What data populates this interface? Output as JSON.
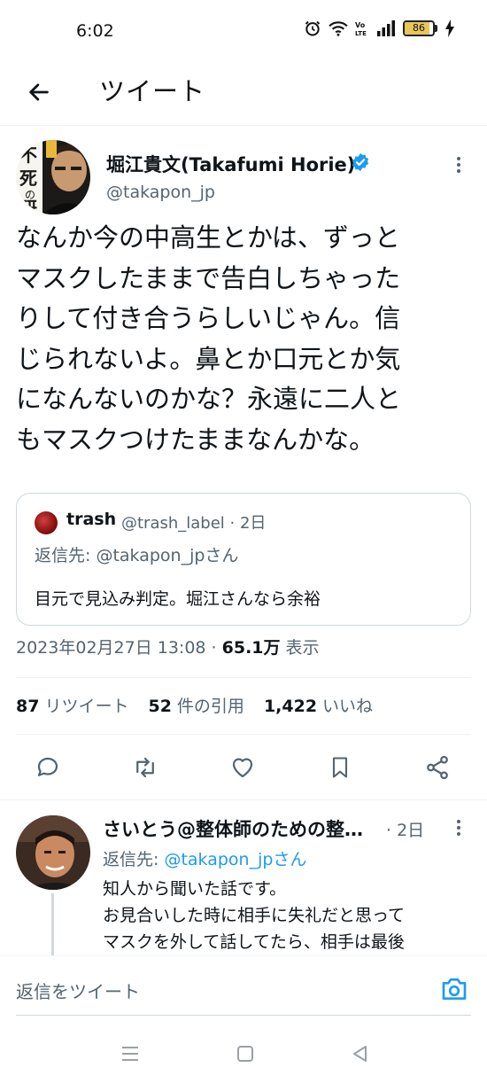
{
  "status_bar": {
    "time": "6:02",
    "battery": "86",
    "battery_level": 0.86
  },
  "header": {
    "title": "ツイート"
  },
  "tweet": {
    "author_name": "堀江貴文(Takafumi Horie)",
    "author_handle": "@takapon_jp",
    "text_lines": [
      "なんか今の中高生とかは、ずっと",
      "マスクしたままで告白しちゃった",
      "りして付き合うらしいじゃん。信",
      "じられないよ。鼻とか口元とか気",
      "になんないのかな？永遠に二人と",
      "もマスクつけたままなんかな。"
    ],
    "quote": {
      "name": "trash",
      "handle_time": "@trash_label · 2日",
      "reply_to": "返信先: @takapon_jpさん",
      "text": "目元で見込み判定。堀江さんなら余裕"
    },
    "timestamp": "2023年02月27日 13:08 · ",
    "views": "65.1万",
    "views_label": " 表示",
    "stats": {
      "retweets": "87",
      "retweets_label": "リツイート",
      "quotes": "52",
      "quotes_label": "件の引用",
      "likes": "1,422",
      "likes_label": "いいね"
    }
  },
  "reply": {
    "name": "さいとう@整体師のための整…",
    "time": "· 2日",
    "reply_to_prefix": "返信先: ",
    "reply_to_handle": "@takapon_jpさん",
    "text_lines": [
      "知人から聞いた話です。",
      "お見合いした時に相手に失礼だと思って",
      "マスクを外して話してたら、相手は最後"
    ]
  },
  "compose": {
    "placeholder": "返信をツイート"
  },
  "colors": {
    "accent": "#1d9bf0",
    "secondary_text": "#536471",
    "primary_text": "#0f1419"
  }
}
